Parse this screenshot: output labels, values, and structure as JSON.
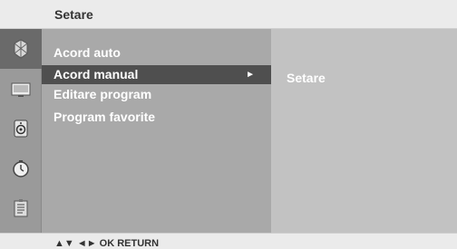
{
  "title": "Setare",
  "sidebar": {
    "icons": [
      {
        "name": "setup-icon",
        "active": true
      },
      {
        "name": "picture-icon",
        "active": false
      },
      {
        "name": "audio-icon",
        "active": false
      },
      {
        "name": "time-icon",
        "active": false
      },
      {
        "name": "option-icon",
        "active": false
      }
    ]
  },
  "menu": {
    "items": [
      {
        "label": "Acord auto"
      },
      {
        "label": "Acord manual",
        "selected": true,
        "arrow": "►"
      },
      {
        "label": "Editare program"
      },
      {
        "label": "Program favorite"
      }
    ]
  },
  "submenu": {
    "label": "Setare"
  },
  "footer": {
    "hint": "▲▼  ◄►  OK  RETURN"
  },
  "colors": {
    "title_bar": "#ebebeb",
    "icon_bar": "#9a9a9a",
    "menu_panel": "#a9a9a9",
    "selected_row": "#4f4f4f",
    "sub_panel": "#c2c2c2",
    "text": "#ffffff"
  }
}
